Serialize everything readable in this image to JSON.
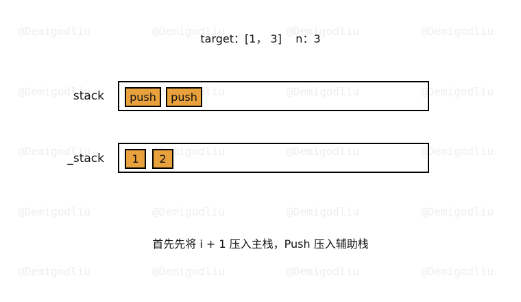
{
  "header": {
    "target_text": "target：[1， 3]    n：3"
  },
  "watermark": {
    "text": "@Demigodliu"
  },
  "stack": {
    "label": "stack",
    "items": [
      "push",
      "push"
    ]
  },
  "aux_stack": {
    "label": "_stack",
    "items": [
      "1",
      "2"
    ]
  },
  "caption": "首先先将 i + 1 压入主栈，Push 压入辅助栈",
  "colors": {
    "cell_fill": "#e8a13c",
    "border": "#000000",
    "watermark": "#eeeeee"
  }
}
